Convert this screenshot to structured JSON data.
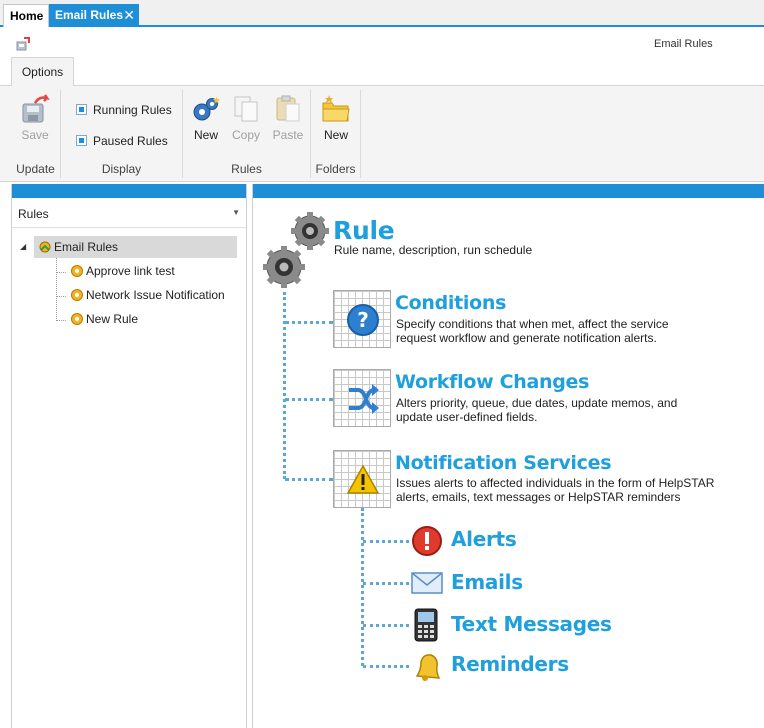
{
  "tabs": {
    "home": "Home",
    "active": "Email Rules"
  },
  "document_title": "Email Rules",
  "ribbon_tab": "Options",
  "ribbon": {
    "update": {
      "save_label": "Save",
      "group_label": "Update"
    },
    "display": {
      "running_rules": "Running Rules",
      "paused_rules": "Paused Rules",
      "group_label": "Display"
    },
    "rules": {
      "new_label": "New",
      "copy_label": "Copy",
      "paste_label": "Paste",
      "group_label": "Rules"
    },
    "folders": {
      "new_label": "New",
      "group_label": "Folders"
    }
  },
  "left_panel": {
    "dropdown_value": "Rules",
    "tree": {
      "root": "Email Rules",
      "children": [
        "Approve link test",
        "Network Issue Notification",
        "New Rule"
      ]
    }
  },
  "diagram": {
    "rule": {
      "title": "Rule",
      "desc": "Rule name, description, run schedule"
    },
    "conditions": {
      "title": "Conditions",
      "desc1": "Specify conditions that when met, affect the service",
      "desc2": "request  workflow and generate notification alerts."
    },
    "workflow": {
      "title": "Workflow Changes",
      "desc1": "Alters priority, queue, due dates, update memos, and",
      "desc2": "update user-defined fields."
    },
    "notification": {
      "title": "Notification Services",
      "desc1": "Issues alerts to affected individuals in the form of HelpSTAR",
      "desc2": "alerts, emails, text messages or HelpSTAR reminders"
    },
    "alerts": "Alerts",
    "emails": "Emails",
    "text_messages": "Text Messages",
    "reminders": "Reminders"
  },
  "colors": {
    "accent": "#1e8fd6",
    "heading": "#1fa0dc"
  }
}
